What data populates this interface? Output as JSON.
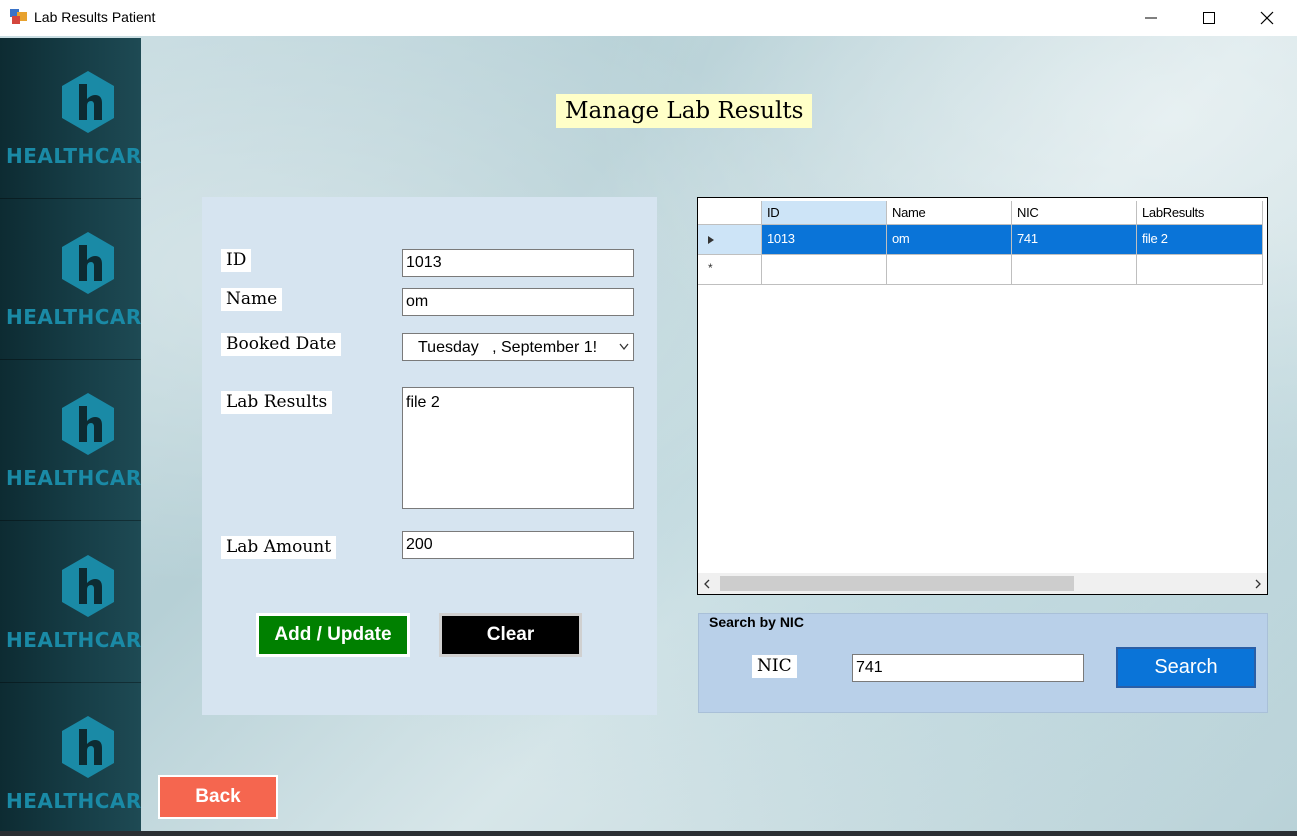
{
  "window": {
    "title": "Lab Results Patient"
  },
  "brand": {
    "name": "HEALTHCARE",
    "color": "#1a8aa6"
  },
  "page": {
    "title": "Manage Lab Results"
  },
  "form": {
    "id_label": "ID",
    "id_value": "1013",
    "name_label": "Name",
    "name_value": "om",
    "booked_date_label": "Booked Date",
    "booked_date_value": "Tuesday   , September 1!",
    "lab_results_label": "Lab Results",
    "lab_results_value": "file 2",
    "lab_amount_label": "Lab Amount",
    "lab_amount_value": "200",
    "add_update_label": "Add / Update",
    "clear_label": "Clear"
  },
  "grid": {
    "columns": [
      "ID",
      "Name",
      "NIC",
      "LabResults"
    ],
    "rows": [
      [
        "1013",
        "om",
        "741",
        "file 2"
      ]
    ],
    "selected_row_color": "#0a74d8"
  },
  "search": {
    "group_label": "Search by NIC",
    "nic_label": "NIC",
    "nic_value": "741",
    "button_label": "Search"
  },
  "back_label": "Back",
  "colors": {
    "add_button": "#008000",
    "clear_button": "#000000",
    "back_button": "#f5664f",
    "search_button": "#0a74d8",
    "title_highlight": "#ffffc8"
  }
}
